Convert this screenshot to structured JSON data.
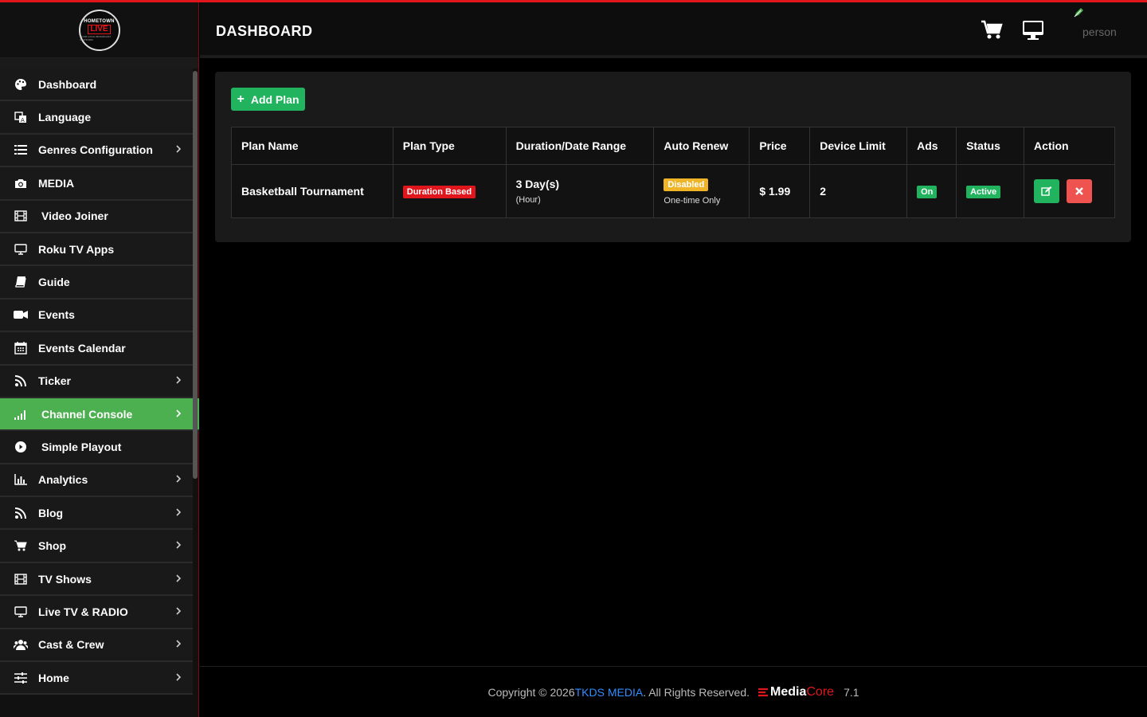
{
  "logo": {
    "line1": "HOMETOWN",
    "line2": "LIVE",
    "line3": "YOUR LOCAL BROADCAST PLATFORM"
  },
  "header": {
    "title": "DASHBOARD",
    "user_label": "person"
  },
  "sidebar": {
    "items": [
      {
        "label": "Dashboard",
        "icon": "palette-icon",
        "chevron": false
      },
      {
        "label": "Language",
        "icon": "language-icon",
        "chevron": false
      },
      {
        "label": "Genres Configuration",
        "icon": "list-icon",
        "chevron": true
      },
      {
        "label": "MEDIA",
        "icon": "camera-icon",
        "chevron": false
      },
      {
        "label": "Video Joiner",
        "icon": "film-icon",
        "chevron": false
      },
      {
        "label": "Roku TV Apps",
        "icon": "monitor-icon",
        "chevron": false
      },
      {
        "label": "Guide",
        "icon": "book-icon",
        "chevron": false
      },
      {
        "label": "Events",
        "icon": "video-camera-icon",
        "chevron": false
      },
      {
        "label": "Events Calendar",
        "icon": "calendar-icon",
        "chevron": false
      },
      {
        "label": "Ticker",
        "icon": "rss-icon",
        "chevron": true
      },
      {
        "label": "Channel Console",
        "icon": "signal-icon",
        "chevron": true,
        "active": true
      },
      {
        "label": "Simple Playout",
        "icon": "play-circle-icon",
        "chevron": false
      },
      {
        "label": "Analytics",
        "icon": "bar-chart-icon",
        "chevron": true
      },
      {
        "label": "Blog",
        "icon": "rss-icon",
        "chevron": true
      },
      {
        "label": "Shop",
        "icon": "cart-icon",
        "chevron": true
      },
      {
        "label": "TV Shows",
        "icon": "film-icon",
        "chevron": true
      },
      {
        "label": "Live TV & RADIO",
        "icon": "monitor-icon",
        "chevron": true
      },
      {
        "label": "Cast & Crew",
        "icon": "users-icon",
        "chevron": true
      },
      {
        "label": "Home",
        "icon": "sliders-icon",
        "chevron": true
      }
    ]
  },
  "main": {
    "add_button_label": "Add Plan",
    "table": {
      "headers": [
        "Plan Name",
        "Plan Type",
        "Duration/Date Range",
        "Auto Renew",
        "Price",
        "Device Limit",
        "Ads",
        "Status",
        "Action"
      ],
      "rows": [
        {
          "plan_name": "Basketball Tournament",
          "plan_type": "Duration Based",
          "duration": "3 Day(s)",
          "duration_unit": "(Hour)",
          "auto_renew": "Disabled",
          "auto_renew_note": "One-time Only",
          "price": "$ 1.99",
          "device_limit": "2",
          "ads": "On",
          "status": "Active"
        }
      ]
    }
  },
  "footer": {
    "copyright": "Copyright © 2026 ",
    "company": "TKDS MEDIA",
    "rights": ". All Rights Reserved.",
    "brand_media": "Media",
    "brand_core": "Core",
    "version": "7.1"
  },
  "colors": {
    "accent_red": "#e0161d",
    "active_green": "#4caf50",
    "button_green": "#22b35e",
    "link_blue": "#2f8dff"
  }
}
